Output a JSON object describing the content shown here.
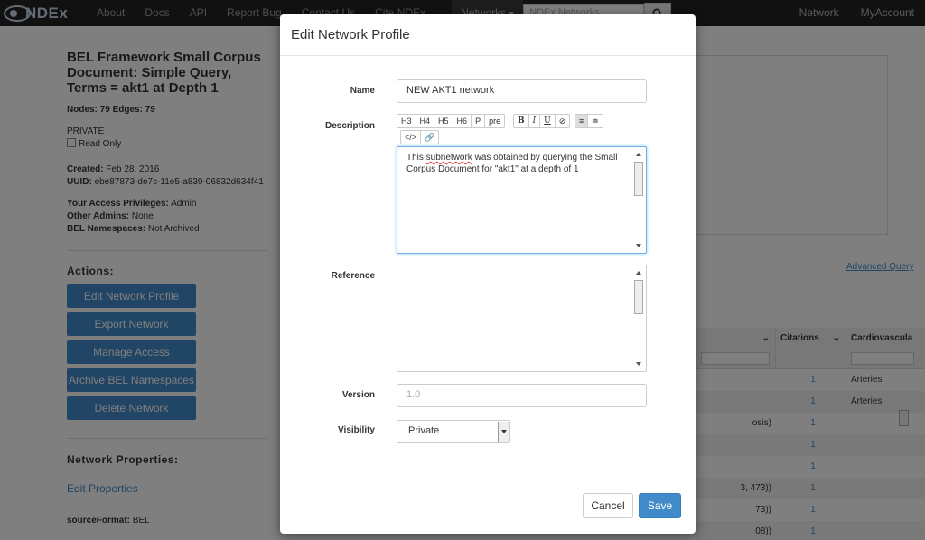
{
  "navbar": {
    "brand": "NDEx",
    "links": [
      "About",
      "Docs",
      "API",
      "Report Bug",
      "Contact Us",
      "Cite NDEx"
    ],
    "search_scope": "Networks",
    "search_placeholder": "NDEx Networks",
    "right_links": [
      "Network",
      "MyAccount"
    ]
  },
  "network": {
    "title": "BEL Framework Small Corpus Document: Simple Query, Terms = akt1 at Depth 1",
    "nodes_label": "Nodes:",
    "nodes": "79",
    "edges_label": "Edges:",
    "edges": "79",
    "visibility": "PRIVATE",
    "read_only_label": "Read Only",
    "created_label": "Created:",
    "created": "Feb 28, 2016",
    "uuid_label": "UUID:",
    "uuid": "ebe87873-de7c-11e5-a839-06832d634f41",
    "access_label": "Your Access Privileges:",
    "access": "Admin",
    "other_admins_label": "Other Admins:",
    "other_admins": "None",
    "bel_ns_label": "BEL Namespaces:",
    "bel_ns": "Not Archived"
  },
  "actions": {
    "heading": "Actions:",
    "buttons": [
      "Edit Network Profile",
      "Export Network",
      "Manage Access",
      "Archive BEL Namespaces",
      "Delete Network"
    ]
  },
  "properties": {
    "heading": "Network Properties:",
    "edit_link": "Edit Properties",
    "source_format_label": "sourceFormat:",
    "source_format": "BEL"
  },
  "query": {
    "advanced_link": "Advanced Query"
  },
  "table": {
    "columns": [
      "Citations",
      "Cardiovascula"
    ],
    "rows": [
      {
        "rel": "",
        "citations": "1",
        "cardio": "Arteries"
      },
      {
        "rel": "",
        "citations": "1",
        "cardio": "Arteries"
      },
      {
        "rel": "osis)",
        "citations": "1",
        "cardio": ""
      },
      {
        "rel": "",
        "citations": "1",
        "cardio": ""
      },
      {
        "rel": "",
        "citations": "1",
        "cardio": ""
      },
      {
        "rel": "3, 473))",
        "citations": "1",
        "cardio": ""
      },
      {
        "rel": "73))",
        "citations": "1",
        "cardio": ""
      },
      {
        "rel": "08))",
        "citations": "1",
        "cardio": ""
      }
    ]
  },
  "modal": {
    "title": "Edit Network Profile",
    "name_label": "Name",
    "name_value": "NEW AKT1 network",
    "description_label": "Description",
    "toolbar": {
      "headings": [
        "H3",
        "H4",
        "H5",
        "H6",
        "P",
        "pre"
      ],
      "format": [
        "B",
        "I",
        "U",
        "⊘"
      ],
      "align": [
        "≡",
        "≐"
      ],
      "extra": [
        "</>",
        "🔗"
      ]
    },
    "description_text_1": "This ",
    "description_spell": "subnetwork",
    "description_text_2": " was obtained by querying the Small Corpus Document for \"akt1\" at a depth of 1",
    "reference_label": "Reference",
    "version_label": "Version",
    "version_placeholder": "1.0",
    "visibility_label": "Visibility",
    "visibility_value": "Private",
    "cancel_label": "Cancel",
    "save_label": "Save"
  }
}
